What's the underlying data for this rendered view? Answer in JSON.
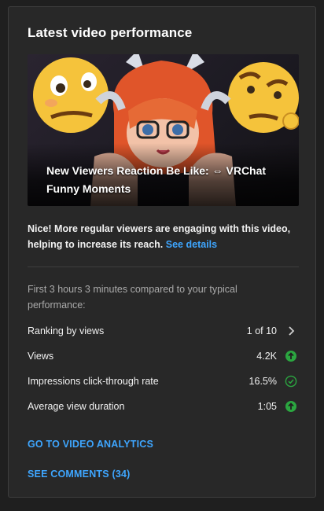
{
  "card": {
    "title": "Latest video performance"
  },
  "video": {
    "title_line1": "New Viewers Reaction Be Like: ⇔ VRChat",
    "title_line2": "Funny Moments"
  },
  "summary": {
    "text": "Nice! More regular viewers are engaging with this video, helping to increase its reach.",
    "link_label": "See details"
  },
  "comparison": {
    "text": "First 3 hours 3 minutes compared to your typical performance:"
  },
  "metrics": [
    {
      "label": "Ranking by views",
      "value": "1 of 10",
      "icon": "chevron-right-icon"
    },
    {
      "label": "Views",
      "value": "4.2K",
      "icon": "arrow-up-circle-icon"
    },
    {
      "label": "Impressions click-through rate",
      "value": "16.5%",
      "icon": "check-circle-icon"
    },
    {
      "label": "Average view duration",
      "value": "1:05",
      "icon": "arrow-up-circle-icon"
    }
  ],
  "actions": {
    "analytics": "GO TO VIDEO ANALYTICS",
    "comments": "SEE COMMENTS (34)"
  },
  "colors": {
    "background": "#1f1f1f",
    "card": "#282828",
    "link": "#3ea6ff",
    "positive": "#2ba640"
  }
}
